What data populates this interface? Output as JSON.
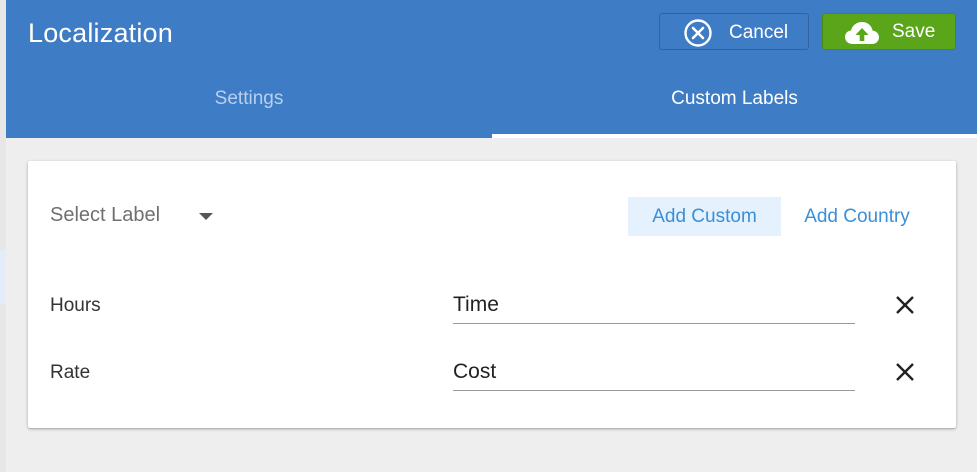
{
  "header": {
    "title": "Localization",
    "cancel_label": "Cancel",
    "save_label": "Save",
    "cancel_icon": "close-circle-icon",
    "save_icon": "cloud-upload-icon",
    "color": "#3e7cc6",
    "save_color": "#5aa51a"
  },
  "tabs": [
    {
      "label": "Settings",
      "active": false
    },
    {
      "label": "Custom Labels",
      "active": true
    }
  ],
  "card": {
    "select_placeholder": "Select Label",
    "add_custom_label": "Add Custom",
    "add_country_label": "Add Country",
    "link_color": "#3a8fd8",
    "rows": [
      {
        "label": "Hours",
        "value": "Time"
      },
      {
        "label": "Rate",
        "value": "Cost"
      }
    ]
  }
}
